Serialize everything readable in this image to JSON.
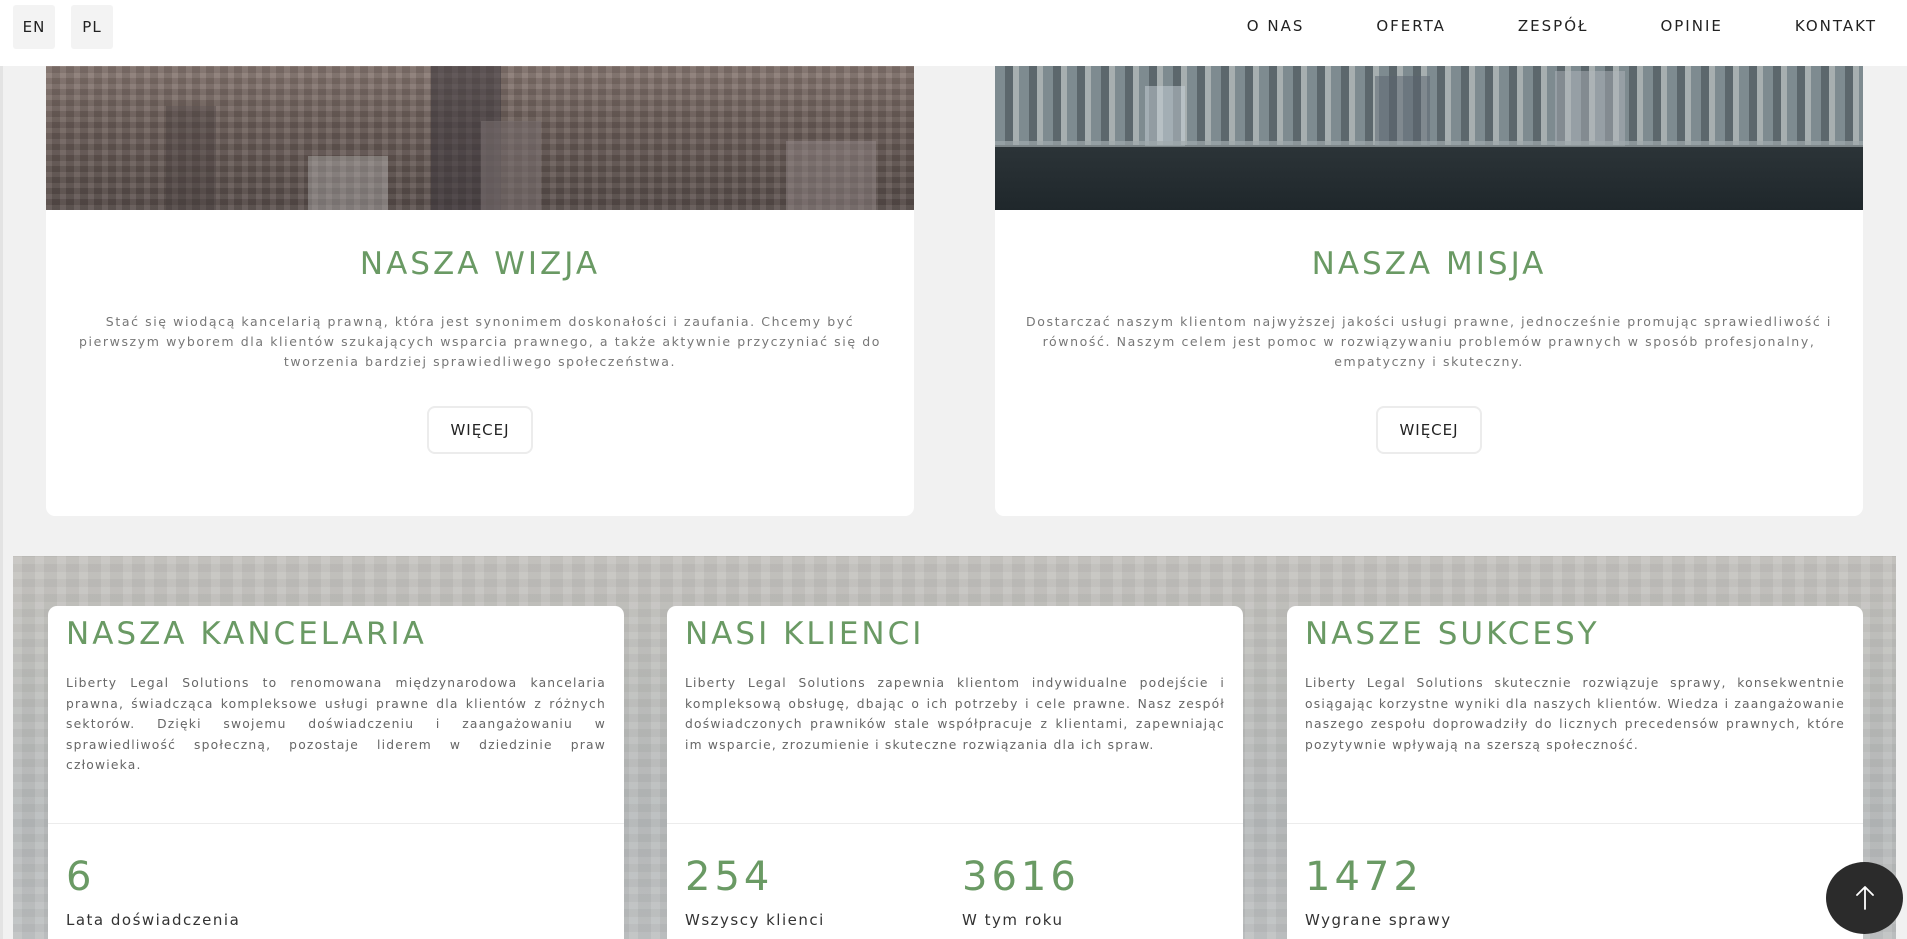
{
  "header": {
    "languages": [
      "EN",
      "PL"
    ],
    "nav": [
      "O NAS",
      "OFERTA",
      "ZESPÓŁ",
      "OPINIE",
      "KONTAKT"
    ]
  },
  "vision": {
    "title": "NASZA WIZJA",
    "text": "Stać się wiodącą kancelarią prawną, która jest synonimem doskonałości i zaufania. Chcemy być pierwszym wyborem dla klientów szukających wsparcia prawnego, a także aktywnie przyczyniać się do tworzenia bardziej sprawiedliwego społeczeństwa.",
    "button": "WIĘCEJ"
  },
  "mission": {
    "title": "NASZA MISJA",
    "text": "Dostarczać naszym klientom najwyższej jakości usługi prawne, jednocześnie promując sprawiedliwość i równość. Naszym celem jest pomoc w rozwiązywaniu problemów prawnych w sposób profesjonalny, empatyczny i skuteczny.",
    "button": "WIĘCEJ"
  },
  "info": {
    "firm": {
      "title": "NASZA KANCELARIA",
      "text": "Liberty Legal Solutions to renomowana międzynarodowa kancelaria prawna, świadcząca kompleksowe usługi prawne dla klientów z różnych sektorów. Dzięki swojemu doświadczeniu i zaangażowaniu w sprawiedliwość społeczną, pozostaje liderem w dziedzinie praw człowieka.",
      "stat1_num": "6",
      "stat1_label": "Lata doświadczenia"
    },
    "clients": {
      "title": "NASI KLIENCI",
      "text": "Liberty Legal Solutions zapewnia klientom indywidualne podejście i kompleksową obsługę, dbając o ich potrzeby i cele prawne. Nasz zespół doświadczonych prawników stale współpracuje z klientami, zapewniając im wsparcie, zrozumienie i skuteczne rozwiązania dla ich spraw.",
      "stat1_num": "254",
      "stat1_label": "Wszyscy klienci",
      "stat2_num": "3616",
      "stat2_label": "W tym roku"
    },
    "success": {
      "title": "NASZE SUKCESY",
      "text": "Liberty Legal Solutions skutecznie rozwiązuje sprawy, konsekwentnie osiągając korzystne wyniki dla naszych klientów. Wiedza i zaangażowanie naszego zespołu doprowadziły do licznych precedensów prawnych, które pozytywnie wpływają na szerszą społeczność.",
      "stat1_num": "1472",
      "stat1_label": "Wygrane sprawy"
    }
  },
  "colors": {
    "accent": "#6a9a64",
    "background": "#f1f1f1",
    "to_top_button": "#2b2b2b"
  },
  "icons": {
    "to_top": "arrow-up-icon"
  }
}
